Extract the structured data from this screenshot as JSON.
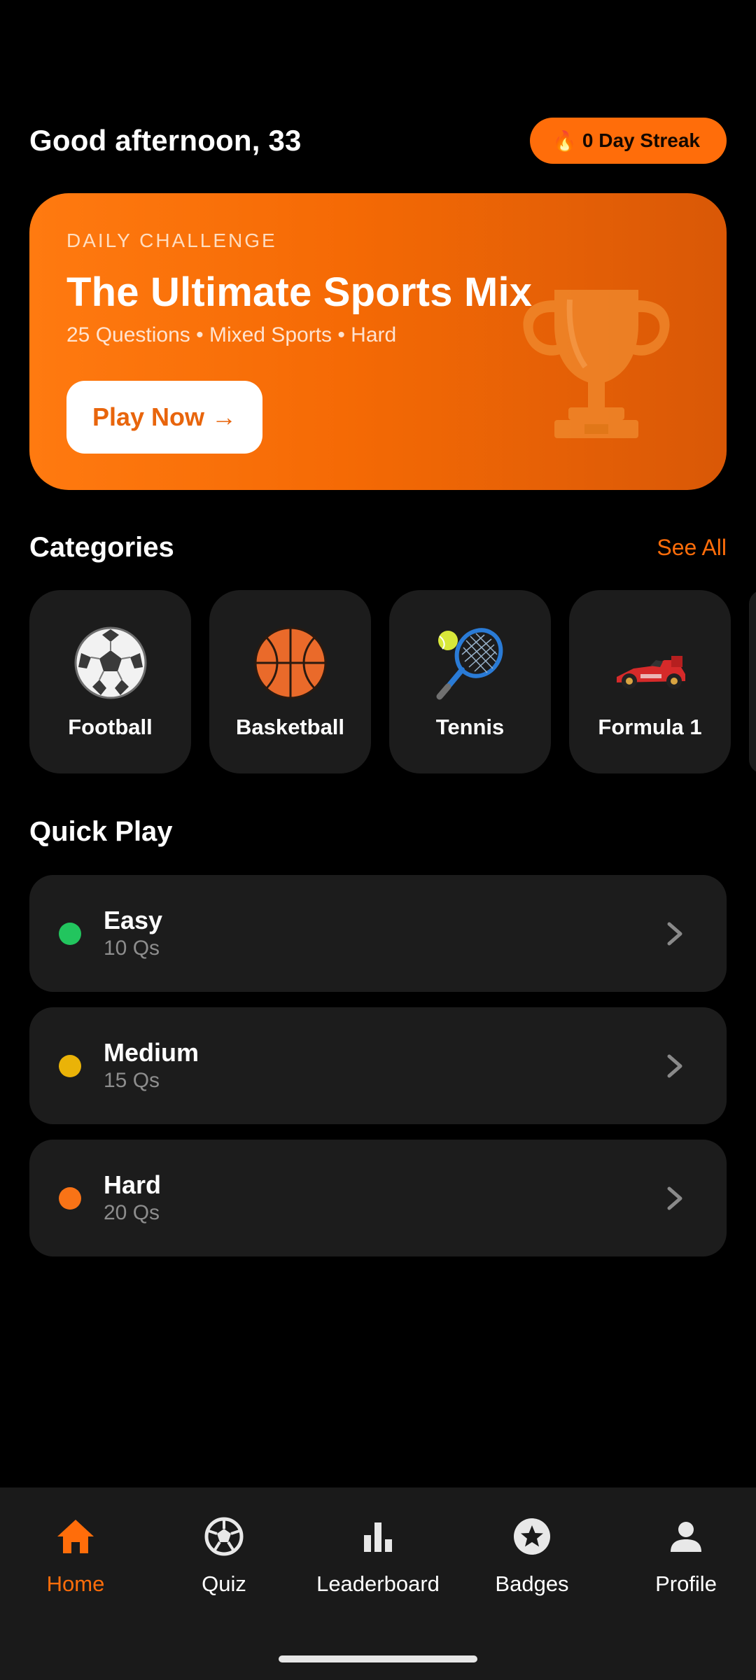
{
  "header": {
    "greeting": "Good afternoon, 33",
    "streak_label": "0 Day Streak",
    "streak_icon": "fire-icon"
  },
  "daily_challenge": {
    "label": "DAILY CHALLENGE",
    "title": "The Ultimate Sports Mix",
    "meta": "25 Questions • Mixed Sports • Hard",
    "button": "Play Now →",
    "icon": "trophy-icon"
  },
  "categories": {
    "title": "Categories",
    "see_all": "See All",
    "items": [
      {
        "label": "Football",
        "icon": "soccer-ball-icon"
      },
      {
        "label": "Basketball",
        "icon": "basketball-icon"
      },
      {
        "label": "Tennis",
        "icon": "tennis-icon"
      },
      {
        "label": "Formula 1",
        "icon": "race-car-icon"
      }
    ]
  },
  "quick_play": {
    "title": "Quick Play",
    "items": [
      {
        "name": "Easy",
        "count": "10 Qs",
        "color": "#22c55e"
      },
      {
        "name": "Medium",
        "count": "15 Qs",
        "color": "#eab308"
      },
      {
        "name": "Hard",
        "count": "20 Qs",
        "color": "#f97316"
      }
    ]
  },
  "nav": {
    "items": [
      {
        "label": "Home",
        "icon": "home-icon",
        "active": true
      },
      {
        "label": "Quiz",
        "icon": "soccer-ball-outline-icon",
        "active": false
      },
      {
        "label": "Leaderboard",
        "icon": "bar-chart-icon",
        "active": false
      },
      {
        "label": "Badges",
        "icon": "star-badge-icon",
        "active": false
      },
      {
        "label": "Profile",
        "icon": "person-icon",
        "active": false
      }
    ]
  },
  "colors": {
    "accent": "#ff6d0a",
    "card": "#1c1c1c",
    "background": "#000000"
  }
}
